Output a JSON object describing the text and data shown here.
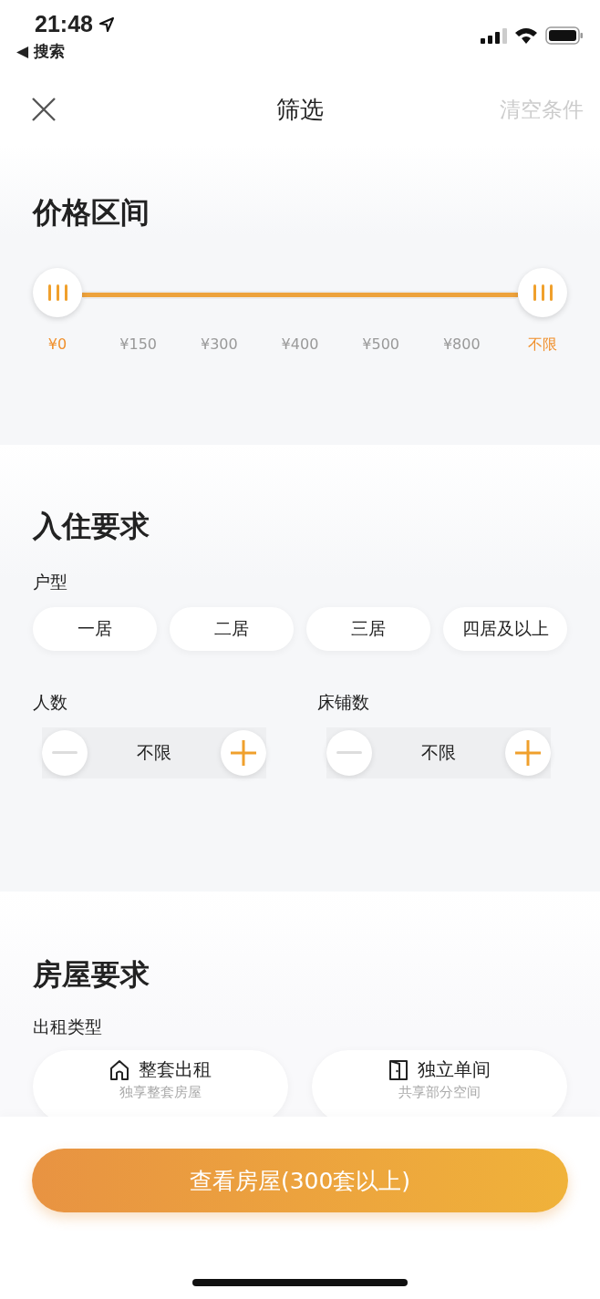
{
  "status_bar": {
    "time": "21:48",
    "back_label": "◀ 搜索"
  },
  "header": {
    "title": "筛选",
    "clear": "清空条件"
  },
  "price": {
    "title": "价格区间",
    "range": {
      "level": 1
    },
    "ticks": [
      {
        "label": "¥0",
        "selected": true
      },
      {
        "label": "¥150",
        "selected": false
      },
      {
        "label": "¥300",
        "selected": false
      },
      {
        "label": "¥400",
        "selected": false
      },
      {
        "label": "¥500",
        "selected": false
      },
      {
        "label": "¥800",
        "selected": false
      },
      {
        "label": "不限",
        "selected": true
      }
    ]
  },
  "occupancy": {
    "title": "入住要求",
    "layout_label": "户型",
    "layouts": [
      {
        "label": "一居",
        "selected": false
      },
      {
        "label": "二居",
        "selected": false
      },
      {
        "label": "三居",
        "selected": false
      },
      {
        "label": "四居及以上",
        "selected": false
      }
    ],
    "steppers": [
      {
        "label": "人数",
        "value": "不限"
      },
      {
        "label": "床铺数",
        "value": "不限"
      }
    ]
  },
  "housing": {
    "title": "房屋要求",
    "rent_label": "出租类型",
    "rent_types": [
      {
        "kind": "house",
        "label": "整套出租",
        "sub": "独享整套房屋",
        "selected": false
      },
      {
        "kind": "door",
        "label": "独立单间",
        "sub": "共享部分空间",
        "selected": false
      }
    ]
  },
  "submit": "查看房屋(300套以上)"
}
